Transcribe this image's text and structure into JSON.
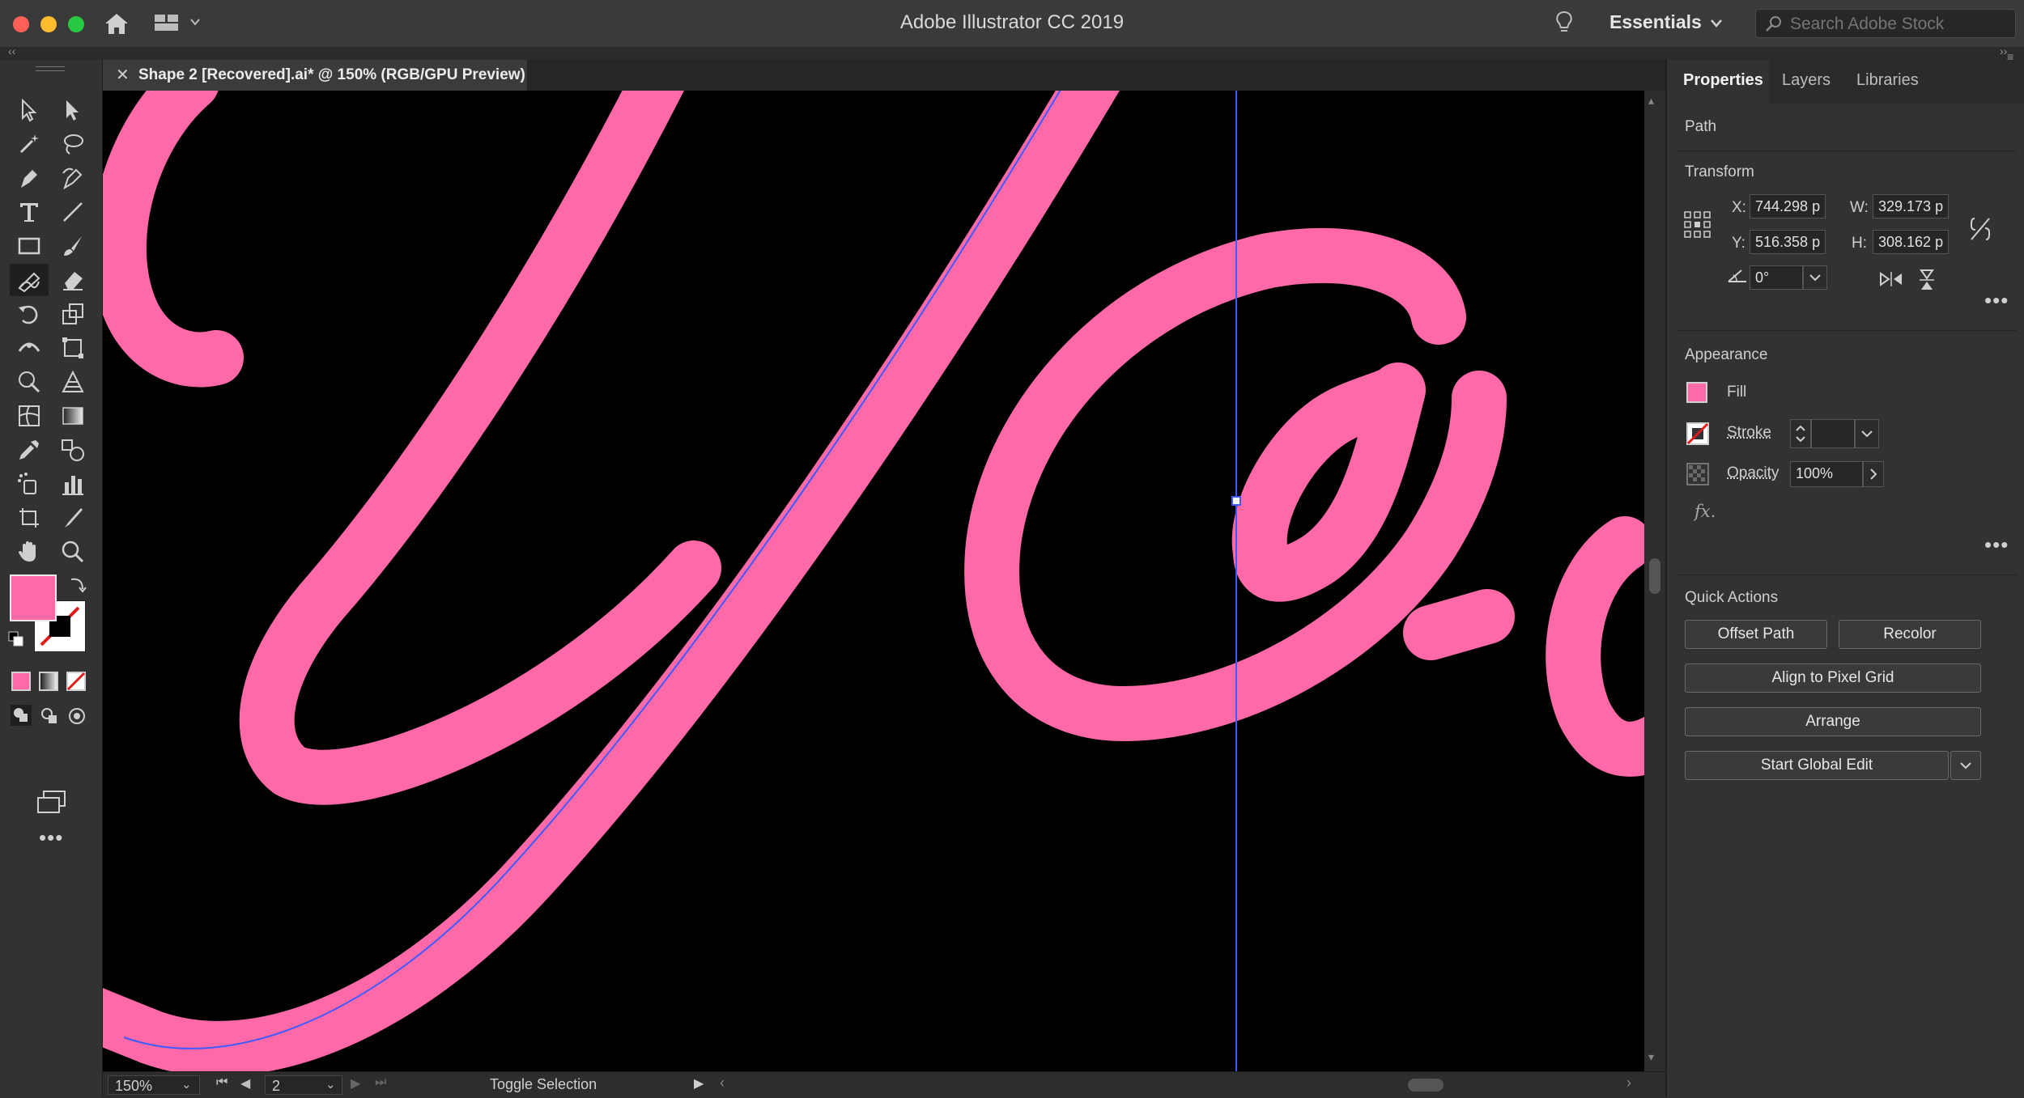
{
  "window": {
    "title": "Adobe Illustrator CC 2019"
  },
  "header": {
    "workspace": "Essentials",
    "search_placeholder": "Search Adobe Stock"
  },
  "document": {
    "tab_title": "Shape 2 [Recovered].ai* @ 150% (RGB/GPU Preview)"
  },
  "panel": {
    "tabs": [
      "Properties",
      "Layers",
      "Libraries"
    ],
    "selection_type": "Path",
    "transform": {
      "title": "Transform",
      "x_label": "X:",
      "x_value": "744.298 p",
      "y_label": "Y:",
      "y_value": "516.358 p",
      "w_label": "W:",
      "w_value": "329.173 p",
      "h_label": "H:",
      "h_value": "308.162 p",
      "angle_value": "0°"
    },
    "appearance": {
      "title": "Appearance",
      "fill_label": "Fill",
      "stroke_label": "Stroke",
      "opacity_label": "Opacity",
      "opacity_value": "100%",
      "fx_label": "fx."
    },
    "quick_actions": {
      "title": "Quick Actions",
      "offset_path": "Offset Path",
      "recolor": "Recolor",
      "align_pixel_grid": "Align to Pixel Grid",
      "arrange": "Arrange",
      "start_global_edit": "Start Global Edit"
    }
  },
  "status": {
    "zoom": "150%",
    "artboard": "2",
    "info": "Toggle Selection"
  },
  "colors": {
    "fill": "#ff69a8",
    "canvas": "#000000",
    "selection": "#3d5bff"
  }
}
